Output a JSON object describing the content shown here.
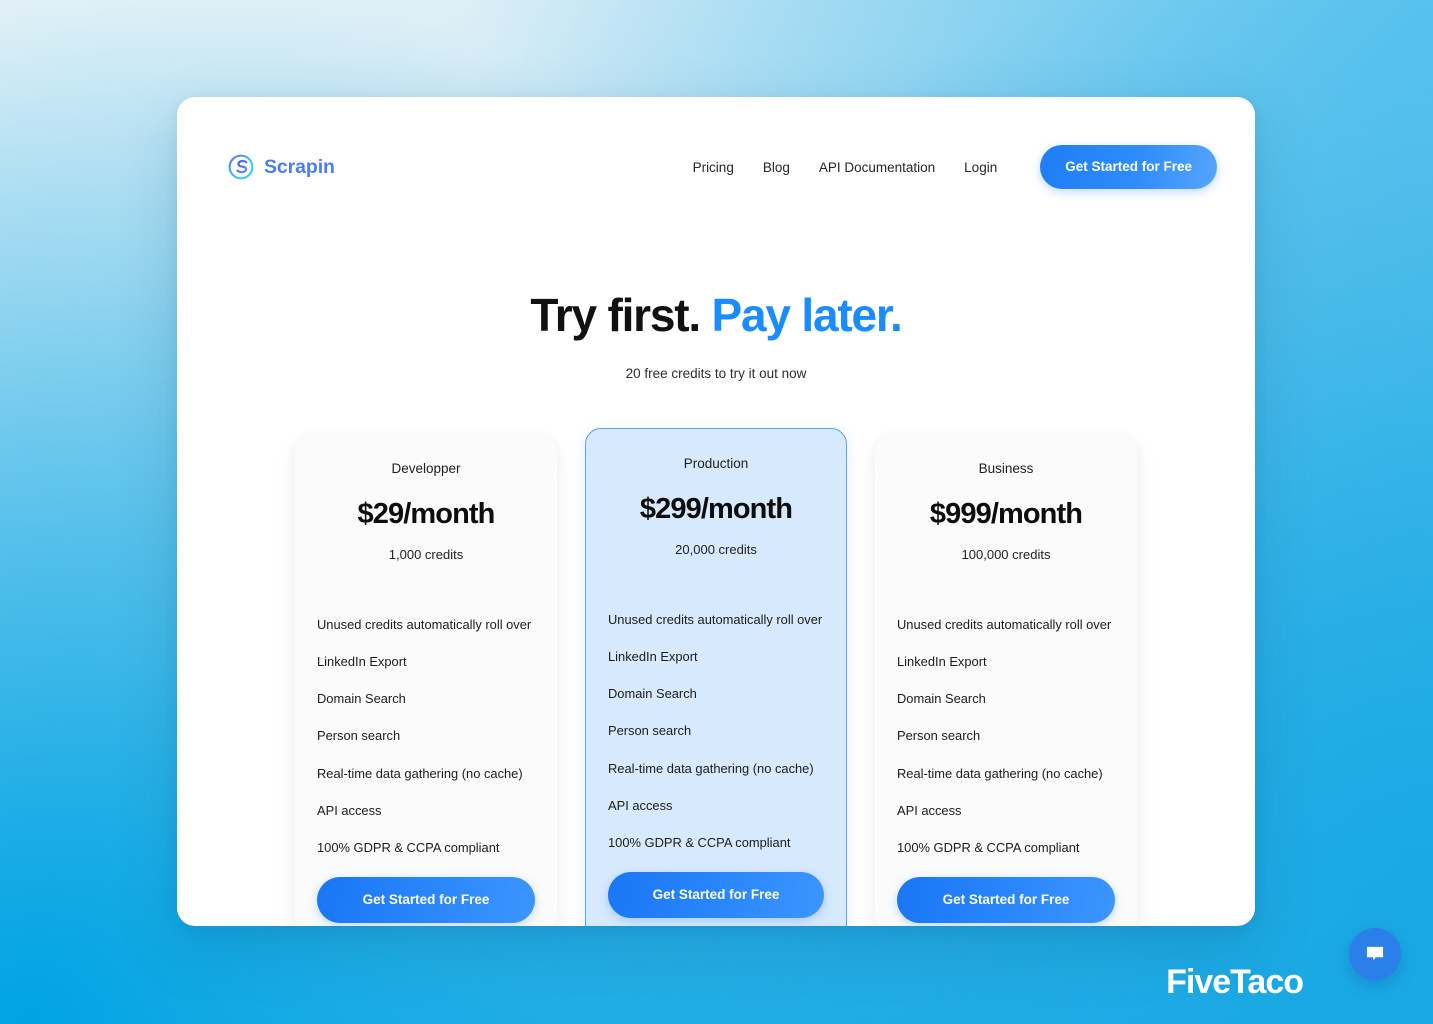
{
  "brand": {
    "name": "Scrapin",
    "logo_icon": "scrapin-s-circle-icon"
  },
  "nav": {
    "links": [
      {
        "label": "Pricing"
      },
      {
        "label": "Blog"
      },
      {
        "label": "API Documentation"
      },
      {
        "label": "Login"
      }
    ],
    "cta_label": "Get Started for Free"
  },
  "hero": {
    "title_plain": "Try first.",
    "title_accent": "Pay later.",
    "subtitle": "20 free credits to try it out now",
    "accent_color": "#1a8cff"
  },
  "pricing": {
    "plans": [
      {
        "name": "Developper",
        "price": "$29/month",
        "credits": "1,000 credits",
        "featured": false,
        "cta_label": "Get Started for Free",
        "features": [
          "Unused credits automatically roll over",
          "LinkedIn Export",
          "Domain Search",
          "Person search",
          "Real-time data gathering (no cache)",
          "API access",
          "100% GDPR & CCPA compliant"
        ]
      },
      {
        "name": "Production",
        "price": "$299/month",
        "credits": "20,000 credits",
        "featured": true,
        "cta_label": "Get Started for Free",
        "features": [
          "Unused credits automatically roll over",
          "LinkedIn Export",
          "Domain Search",
          "Person search",
          "Real-time data gathering (no cache)",
          "API access",
          "100% GDPR & CCPA compliant"
        ]
      },
      {
        "name": "Business",
        "price": "$999/month",
        "credits": "100,000 credits",
        "featured": false,
        "cta_label": "Get Started for Free",
        "features": [
          "Unused credits automatically roll over",
          "LinkedIn Export",
          "Domain Search",
          "Person search",
          "Real-time data gathering (no cache)",
          "API access",
          "100% GDPR & CCPA compliant"
        ]
      }
    ]
  },
  "chat": {
    "icon": "chat-bubble-icon",
    "color": "#2b7fe8"
  },
  "watermark": {
    "text": "FiveTaco"
  },
  "theme": {
    "primary_blue": "#2b87fb",
    "featured_card_bg": "#d7e9fd",
    "featured_card_border": "#5aa0ea",
    "background_top_left": "#eef5f8",
    "background_bottom_left": "#00a3e3"
  }
}
